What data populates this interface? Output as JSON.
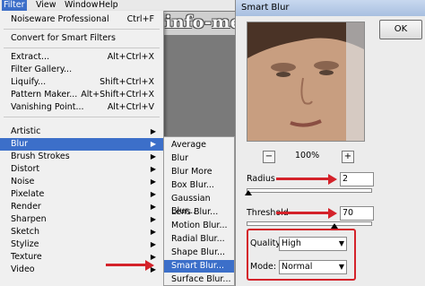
{
  "menubar": {
    "items": [
      {
        "label": "Filter",
        "active": true
      },
      {
        "label": "View",
        "active": false
      },
      {
        "label": "Window",
        "active": false
      },
      {
        "label": "Help",
        "active": false
      }
    ]
  },
  "watermark": {
    "text": "info-menarik.NET"
  },
  "filter_menu": {
    "noiseware": {
      "label": "Noiseware Professional",
      "shortcut": "Ctrl+F"
    },
    "convert": {
      "label": "Convert for Smart Filters"
    },
    "extract": {
      "label": "Extract...",
      "shortcut": "Alt+Ctrl+X"
    },
    "gallery": {
      "label": "Filter Gallery..."
    },
    "liquify": {
      "label": "Liquify...",
      "shortcut": "Shift+Ctrl+X"
    },
    "pattern": {
      "label": "Pattern Maker...",
      "shortcut": "Alt+Shift+Ctrl+X"
    },
    "vanishing": {
      "label": "Vanishing Point...",
      "shortcut": "Alt+Ctrl+V"
    },
    "submenus": [
      "Artistic",
      "Blur",
      "Brush Strokes",
      "Distort",
      "Noise",
      "Pixelate",
      "Render",
      "Sharpen",
      "Sketch",
      "Stylize",
      "Texture",
      "Video"
    ]
  },
  "blur_submenu": {
    "items": [
      "Average",
      "Blur",
      "Blur More",
      "Box Blur...",
      "Gaussian Blur...",
      "Lens Blur...",
      "Motion Blur...",
      "Radial Blur...",
      "Shape Blur...",
      "Smart Blur...",
      "Surface Blur..."
    ],
    "highlighted": "Smart Blur..."
  },
  "dialog": {
    "title": "Smart Blur",
    "ok_label": "OK",
    "zoom_out": "−",
    "zoom_in": "+",
    "zoom_level": "100%",
    "radius_label": "Radius",
    "radius_value": "2",
    "threshold_label": "Threshold",
    "threshold_value": "70",
    "quality_label": "Quality:",
    "quality_value": "High",
    "mode_label": "Mode:",
    "mode_value": "Normal"
  },
  "colors": {
    "highlight": "#3c6fc9",
    "annotation": "#d4222a"
  }
}
